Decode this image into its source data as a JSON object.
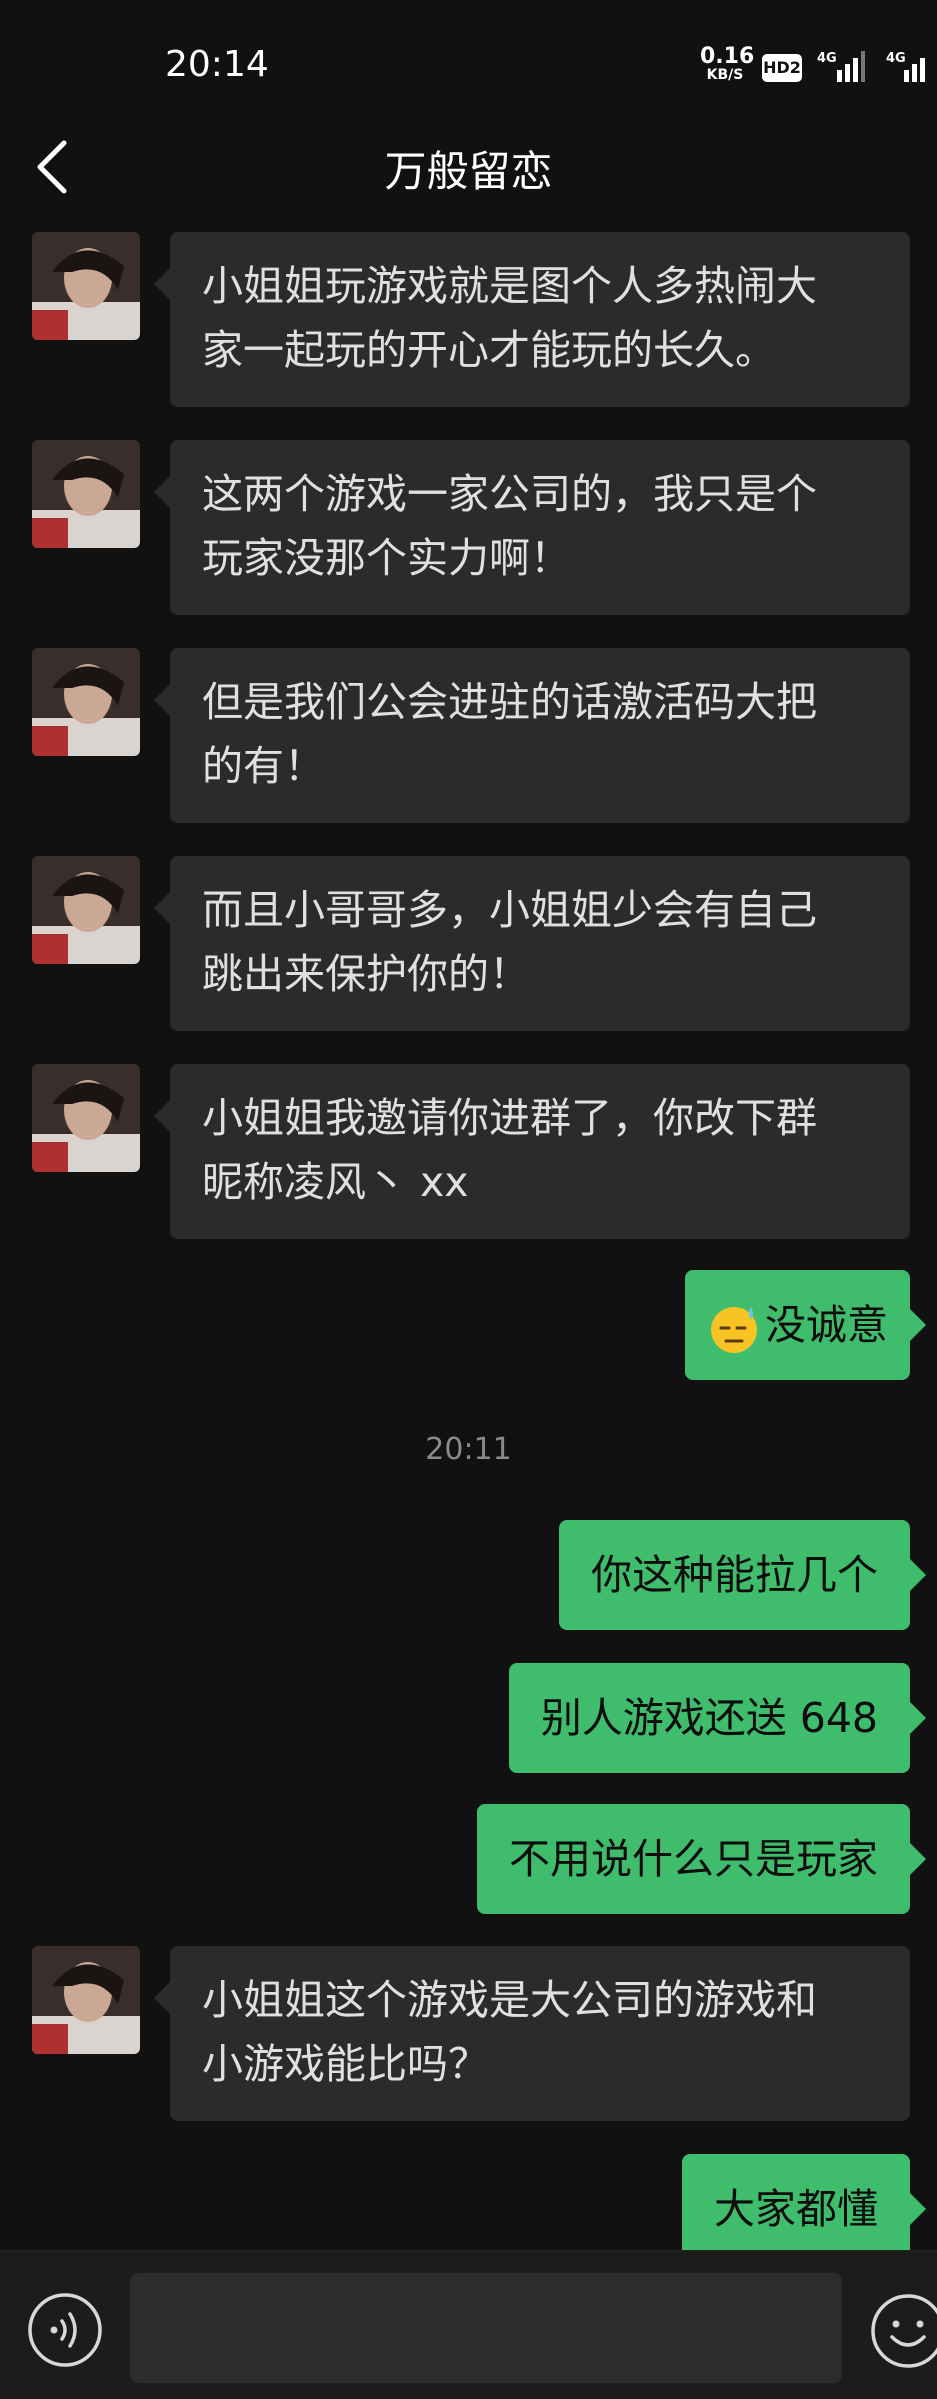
{
  "status_bar": {
    "time": "20:14",
    "net_speed_value": "0.16",
    "net_speed_unit": "KB/S",
    "hd_badge": "HD2",
    "signal_1_label": "4G",
    "signal_2_label": "4G"
  },
  "header": {
    "title": "万般留恋",
    "back_icon": "chevron-left-icon"
  },
  "messages": [
    {
      "side": "in",
      "lines": [
        "小姐姐玩游戏就是图个人多热闹大",
        "家一起玩的开心才能玩的长久。"
      ]
    },
    {
      "side": "in",
      "lines": [
        "这两个游戏一家公司的，我只是个",
        "玩家没那个实力啊！"
      ]
    },
    {
      "side": "in",
      "lines": [
        "但是我们公会进驻的话激活码大把",
        "的有！"
      ]
    },
    {
      "side": "in",
      "lines": [
        "而且小哥哥多，小姐姐少会有自己",
        "跳出来保护你的！"
      ]
    },
    {
      "side": "in",
      "lines": [
        "小姐姐我邀请你进群了，你改下群",
        "昵称凌风丶 xx"
      ]
    },
    {
      "side": "out",
      "emoji": "sweat-smile-emoji",
      "text": "没诚意"
    },
    {
      "type": "time",
      "text": "20:11"
    },
    {
      "side": "out",
      "text": "你这种能拉几个"
    },
    {
      "side": "out",
      "text": "别人游戏还送 648"
    },
    {
      "side": "out",
      "text": "不用说什么只是玩家"
    },
    {
      "side": "in",
      "lines": [
        "小姐姐这个游戏是大公司的游戏和",
        "小游戏能比吗？"
      ]
    },
    {
      "side": "out",
      "text": "大家都懂"
    }
  ],
  "input_bar": {
    "voice_icon": "voice-icon",
    "input_value": "",
    "emoji_icon": "smiley-icon"
  },
  "colors": {
    "background": "#111111",
    "incoming_bubble": "#2b2b2b",
    "outgoing_bubble": "#3fbc6c"
  }
}
